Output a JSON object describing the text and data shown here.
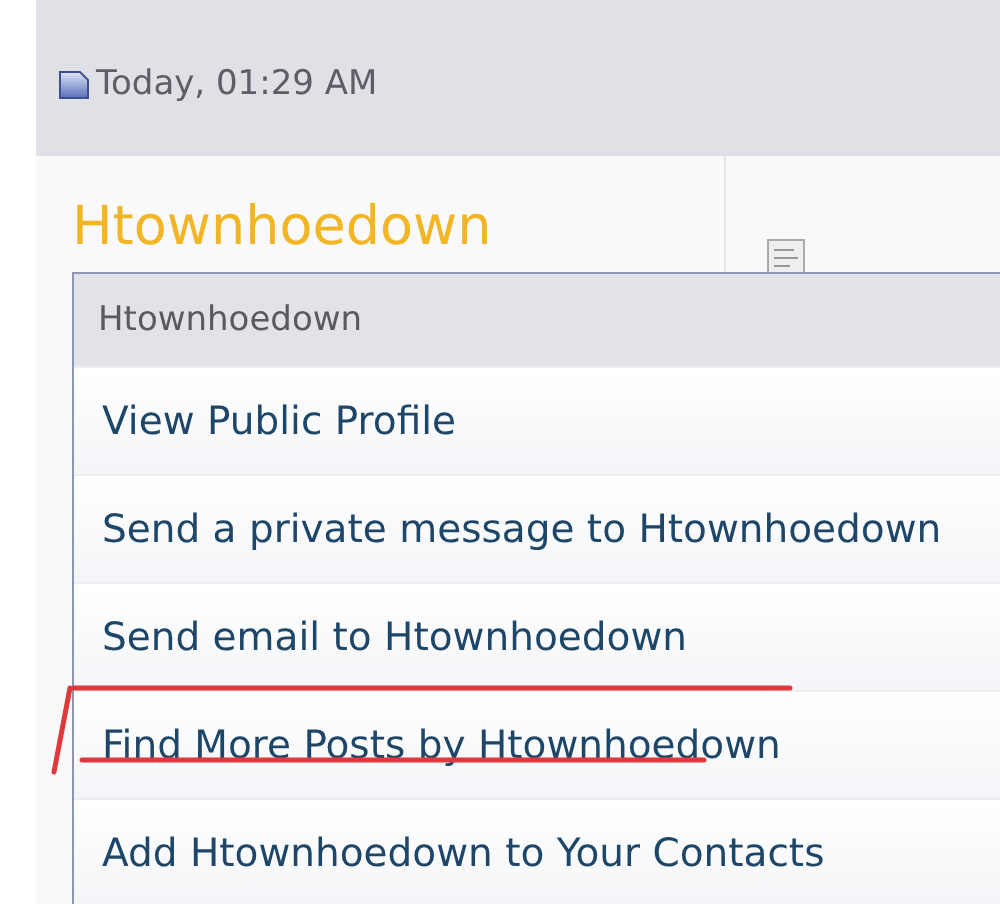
{
  "post_header": {
    "date": "Today, 01:29 AM"
  },
  "author": {
    "username": "Htownhoedown"
  },
  "user_menu": {
    "title": "Htownhoedown",
    "items": [
      "View Public Profile",
      "Send a private message to Htownhoedown",
      "Send email to Htownhoedown",
      "Find More Posts by Htownhoedown",
      "Add Htownhoedown to Your Contacts"
    ]
  }
}
